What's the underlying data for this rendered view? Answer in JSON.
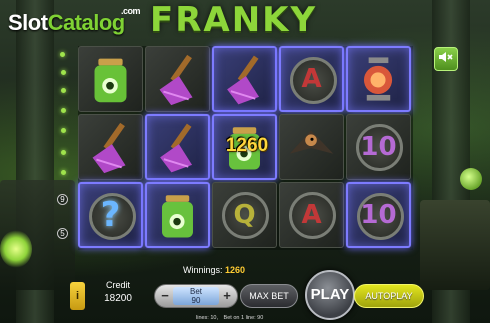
{
  "watermark": {
    "slot": "Slot",
    "catalog": "Catalog",
    "domain": ".com"
  },
  "game": {
    "title": "FRANKY"
  },
  "controls": {
    "mute_icon": "speaker-mute-icon",
    "info_label": "i",
    "credit_label": "Credit",
    "credit_value": "18200",
    "bet_label": "Bet",
    "bet_value": "90",
    "bet_minus": "−",
    "bet_plus": "+",
    "maxbet_label": "MAX BET",
    "play_label": "PLAY",
    "autoplay_label": "AUTOPLAY"
  },
  "winnings": {
    "label": "Winnings:",
    "value": "1260"
  },
  "status": {
    "lines": "lines: 10,",
    "bet_on_line": "Bet on 1 line: 90"
  },
  "paylines": {
    "left_numbers": [
      "9",
      "5"
    ]
  },
  "reels": {
    "win_amount": "1260",
    "rows": [
      [
        {
          "symbol": "jar",
          "win": false
        },
        {
          "symbol": "broom",
          "win": false
        },
        {
          "symbol": "broom",
          "win": true
        },
        {
          "symbol": "A",
          "win": true
        },
        {
          "symbol": "lamp",
          "win": true
        }
      ],
      [
        {
          "symbol": "broom",
          "win": false
        },
        {
          "symbol": "broom",
          "win": true
        },
        {
          "symbol": "jar",
          "win": true
        },
        {
          "symbol": "vulture",
          "win": false
        },
        {
          "symbol": "10",
          "win": false
        }
      ],
      [
        {
          "symbol": "?",
          "win": true
        },
        {
          "symbol": "jar",
          "win": true
        },
        {
          "symbol": "Q",
          "win": false
        },
        {
          "symbol": "A",
          "win": false
        },
        {
          "symbol": "10",
          "win": true
        }
      ]
    ]
  },
  "colors": {
    "accent_green": "#8dd63a",
    "win_frame": "#7d7bff",
    "win_text": "#ffd63d",
    "autoplay": "#c9cc14"
  }
}
